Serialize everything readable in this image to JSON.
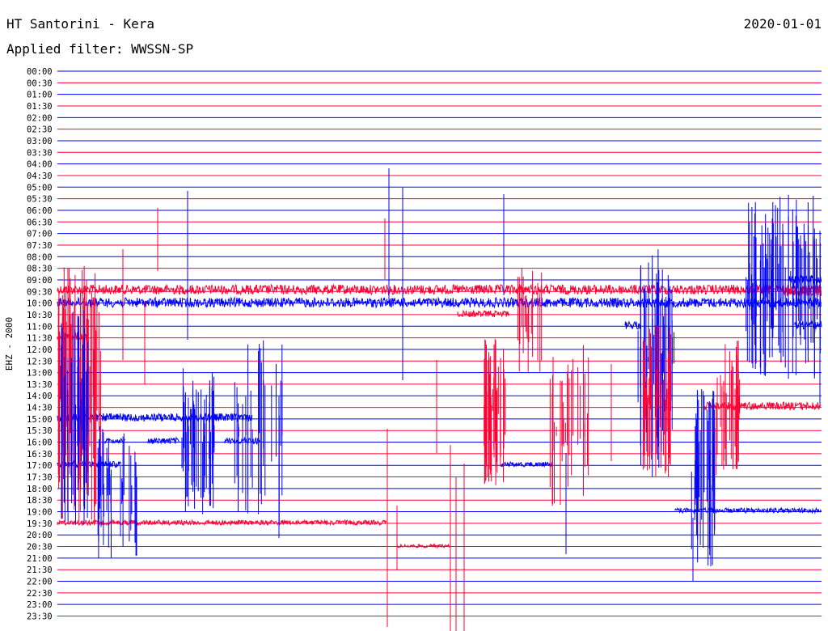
{
  "header": {
    "station": "HT Santorini - Kera",
    "date": "2020-01-01",
    "filter": "Applied filter: WWSSN-SP"
  },
  "chart_data": {
    "type": "line",
    "title": "HT Santorini - Kera",
    "subtitle": "Applied filter: WWSSN-SP",
    "date": "2020-01-01",
    "ylabel": "EHZ - 2000",
    "xlabel": "",
    "x_range_minutes": [
      0,
      30
    ],
    "row_labels": [
      "00:00",
      "00:30",
      "01:00",
      "01:30",
      "02:00",
      "02:30",
      "03:00",
      "03:30",
      "04:00",
      "04:30",
      "05:00",
      "05:30",
      "06:00",
      "06:30",
      "07:00",
      "07:30",
      "08:00",
      "08:30",
      "09:00",
      "09:30",
      "10:00",
      "10:30",
      "11:00",
      "11:30",
      "12:00",
      "12:30",
      "13:00",
      "13:30",
      "14:00",
      "14:30",
      "15:00",
      "15:30",
      "16:00",
      "16:30",
      "17:00",
      "17:30",
      "18:00",
      "18:30",
      "19:00",
      "19:30",
      "20:00",
      "20:30",
      "21:00",
      "21:30",
      "22:00",
      "22:30",
      "23:00",
      "23:30"
    ],
    "trace_colors": [
      "#0000ff",
      "#ff0033"
    ],
    "grid": false,
    "legend": "none"
  }
}
